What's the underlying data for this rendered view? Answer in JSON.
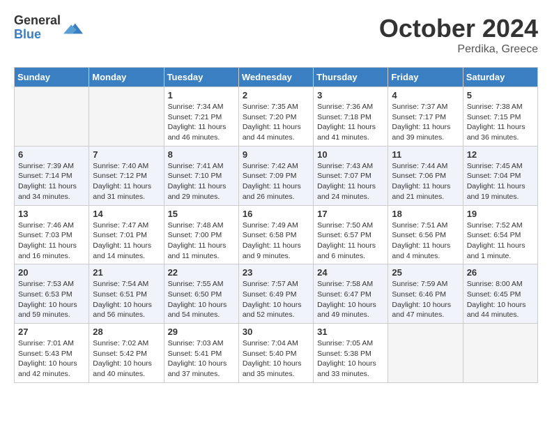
{
  "header": {
    "logo_general": "General",
    "logo_blue": "Blue",
    "month_title": "October 2024",
    "location": "Perdika, Greece"
  },
  "weekdays": [
    "Sunday",
    "Monday",
    "Tuesday",
    "Wednesday",
    "Thursday",
    "Friday",
    "Saturday"
  ],
  "weeks": [
    [
      {
        "day": "",
        "info": ""
      },
      {
        "day": "",
        "info": ""
      },
      {
        "day": "1",
        "info": "Sunrise: 7:34 AM\nSunset: 7:21 PM\nDaylight: 11 hours and 46 minutes."
      },
      {
        "day": "2",
        "info": "Sunrise: 7:35 AM\nSunset: 7:20 PM\nDaylight: 11 hours and 44 minutes."
      },
      {
        "day": "3",
        "info": "Sunrise: 7:36 AM\nSunset: 7:18 PM\nDaylight: 11 hours and 41 minutes."
      },
      {
        "day": "4",
        "info": "Sunrise: 7:37 AM\nSunset: 7:17 PM\nDaylight: 11 hours and 39 minutes."
      },
      {
        "day": "5",
        "info": "Sunrise: 7:38 AM\nSunset: 7:15 PM\nDaylight: 11 hours and 36 minutes."
      }
    ],
    [
      {
        "day": "6",
        "info": "Sunrise: 7:39 AM\nSunset: 7:14 PM\nDaylight: 11 hours and 34 minutes."
      },
      {
        "day": "7",
        "info": "Sunrise: 7:40 AM\nSunset: 7:12 PM\nDaylight: 11 hours and 31 minutes."
      },
      {
        "day": "8",
        "info": "Sunrise: 7:41 AM\nSunset: 7:10 PM\nDaylight: 11 hours and 29 minutes."
      },
      {
        "day": "9",
        "info": "Sunrise: 7:42 AM\nSunset: 7:09 PM\nDaylight: 11 hours and 26 minutes."
      },
      {
        "day": "10",
        "info": "Sunrise: 7:43 AM\nSunset: 7:07 PM\nDaylight: 11 hours and 24 minutes."
      },
      {
        "day": "11",
        "info": "Sunrise: 7:44 AM\nSunset: 7:06 PM\nDaylight: 11 hours and 21 minutes."
      },
      {
        "day": "12",
        "info": "Sunrise: 7:45 AM\nSunset: 7:04 PM\nDaylight: 11 hours and 19 minutes."
      }
    ],
    [
      {
        "day": "13",
        "info": "Sunrise: 7:46 AM\nSunset: 7:03 PM\nDaylight: 11 hours and 16 minutes."
      },
      {
        "day": "14",
        "info": "Sunrise: 7:47 AM\nSunset: 7:01 PM\nDaylight: 11 hours and 14 minutes."
      },
      {
        "day": "15",
        "info": "Sunrise: 7:48 AM\nSunset: 7:00 PM\nDaylight: 11 hours and 11 minutes."
      },
      {
        "day": "16",
        "info": "Sunrise: 7:49 AM\nSunset: 6:58 PM\nDaylight: 11 hours and 9 minutes."
      },
      {
        "day": "17",
        "info": "Sunrise: 7:50 AM\nSunset: 6:57 PM\nDaylight: 11 hours and 6 minutes."
      },
      {
        "day": "18",
        "info": "Sunrise: 7:51 AM\nSunset: 6:56 PM\nDaylight: 11 hours and 4 minutes."
      },
      {
        "day": "19",
        "info": "Sunrise: 7:52 AM\nSunset: 6:54 PM\nDaylight: 11 hours and 1 minute."
      }
    ],
    [
      {
        "day": "20",
        "info": "Sunrise: 7:53 AM\nSunset: 6:53 PM\nDaylight: 10 hours and 59 minutes."
      },
      {
        "day": "21",
        "info": "Sunrise: 7:54 AM\nSunset: 6:51 PM\nDaylight: 10 hours and 56 minutes."
      },
      {
        "day": "22",
        "info": "Sunrise: 7:55 AM\nSunset: 6:50 PM\nDaylight: 10 hours and 54 minutes."
      },
      {
        "day": "23",
        "info": "Sunrise: 7:57 AM\nSunset: 6:49 PM\nDaylight: 10 hours and 52 minutes."
      },
      {
        "day": "24",
        "info": "Sunrise: 7:58 AM\nSunset: 6:47 PM\nDaylight: 10 hours and 49 minutes."
      },
      {
        "day": "25",
        "info": "Sunrise: 7:59 AM\nSunset: 6:46 PM\nDaylight: 10 hours and 47 minutes."
      },
      {
        "day": "26",
        "info": "Sunrise: 8:00 AM\nSunset: 6:45 PM\nDaylight: 10 hours and 44 minutes."
      }
    ],
    [
      {
        "day": "27",
        "info": "Sunrise: 7:01 AM\nSunset: 5:43 PM\nDaylight: 10 hours and 42 minutes."
      },
      {
        "day": "28",
        "info": "Sunrise: 7:02 AM\nSunset: 5:42 PM\nDaylight: 10 hours and 40 minutes."
      },
      {
        "day": "29",
        "info": "Sunrise: 7:03 AM\nSunset: 5:41 PM\nDaylight: 10 hours and 37 minutes."
      },
      {
        "day": "30",
        "info": "Sunrise: 7:04 AM\nSunset: 5:40 PM\nDaylight: 10 hours and 35 minutes."
      },
      {
        "day": "31",
        "info": "Sunrise: 7:05 AM\nSunset: 5:38 PM\nDaylight: 10 hours and 33 minutes."
      },
      {
        "day": "",
        "info": ""
      },
      {
        "day": "",
        "info": ""
      }
    ]
  ]
}
